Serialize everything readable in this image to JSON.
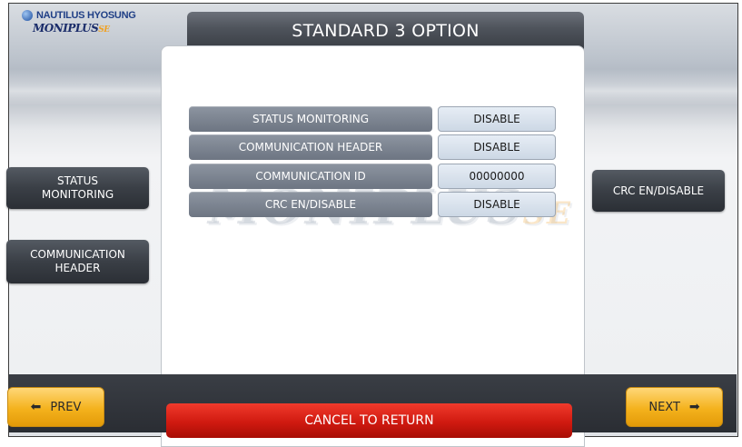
{
  "brand": {
    "company": "NAUTILUS HYOSUNG",
    "product": "MONIPLUS",
    "edition": "SE",
    "watermark": "MONIPLUS",
    "watermark_edition": "SE"
  },
  "header": {
    "title": "STANDARD 3 OPTION"
  },
  "settings": [
    {
      "label": "STATUS MONITORING",
      "value": "DISABLE"
    },
    {
      "label": "COMMUNICATION HEADER",
      "value": "DISABLE"
    },
    {
      "label": "COMMUNICATION ID",
      "value": "00000000"
    },
    {
      "label": "CRC EN/DISABLE",
      "value": "DISABLE"
    }
  ],
  "side_buttons": {
    "left": [
      {
        "line1": "STATUS",
        "line2": "MONITORING"
      },
      {
        "line1": "COMMUNICATION",
        "line2": "HEADER"
      }
    ],
    "right": [
      {
        "label": "CRC EN/DISABLE"
      }
    ]
  },
  "footer": {
    "prev_label": "PREV",
    "next_label": "NEXT",
    "cancel_label": "CANCEL TO RETURN"
  },
  "icons": {
    "prev_arrow": "arrow-left-icon",
    "next_arrow": "arrow-right-icon"
  },
  "colors": {
    "accent_yellow": "#f4b21d",
    "cancel_red": "#d01a10",
    "title_dark": "#4e535b"
  }
}
